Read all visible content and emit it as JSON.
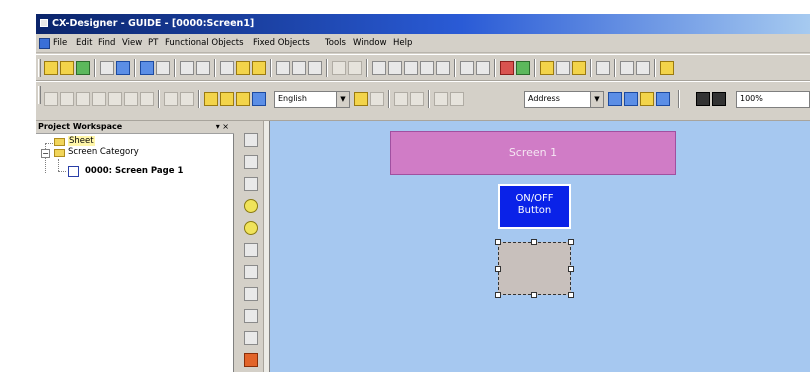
{
  "window": {
    "title": "CX-Designer - GUIDE - [0000:Screen1]"
  },
  "menu": {
    "items": [
      "File",
      "Edit",
      "Find",
      "View",
      "PT",
      "Functional Objects",
      "Fixed Objects",
      "Tools",
      "Window",
      "Help"
    ]
  },
  "toolbar2": {
    "language": "English",
    "address": "Address",
    "zoom": "100%"
  },
  "workspace": {
    "title": "Project Workspace",
    "header_buttons": "▾ ×",
    "tree": {
      "sheet": "Sheet",
      "screen_category": "Screen Category",
      "screen_page": "0000: Screen Page 1"
    }
  },
  "canvas": {
    "screen_label": "Screen 1",
    "button_label_line1": "ON/OFF",
    "button_label_line2": "Button"
  },
  "colors": {
    "canvas_bg": "#a6c8f0",
    "screen_title_bg": "#d07cc6",
    "onoff_button_bg": "#0a22e8",
    "selected_object_bg": "#c8c0bc"
  },
  "icons": {
    "toolbar1": [
      "new-icon",
      "open-icon",
      "save-all-icon",
      "new-page-icon",
      "save-icon",
      "copy-screen-icon",
      "paste-screen-icon",
      "grid-icon",
      "grid2-icon",
      "cut-icon",
      "copy-icon",
      "paste-icon",
      "print-preview-icon",
      "print-icon",
      "undo-icon",
      "redo-icon",
      "align-icon",
      "copy2-icon",
      "paste2-icon",
      "delete-icon",
      "properties-icon",
      "find-icon",
      "replace-icon",
      "test-icon",
      "transfer-icon",
      "simulate-icon",
      "compile-icon",
      "help-icon"
    ],
    "toolbar2": [
      "select-rect-icon",
      "ellipse-icon",
      "line-icon",
      "polyline-icon",
      "polygon-icon",
      "fan-icon",
      "front-icon",
      "back-icon",
      "group-icon",
      "ungroup-icon",
      "bring-icon",
      "send-icon"
    ],
    "objects": [
      "on-off-button-icon",
      "word-button-icon",
      "command-button-icon",
      "bit-lamp-icon",
      "word-lamp-icon",
      "numeral-display-icon",
      "string-display-icon",
      "list-selector-icon",
      "data-log-graph-icon",
      "thumbwheel-icon",
      "alarm-icon"
    ]
  }
}
